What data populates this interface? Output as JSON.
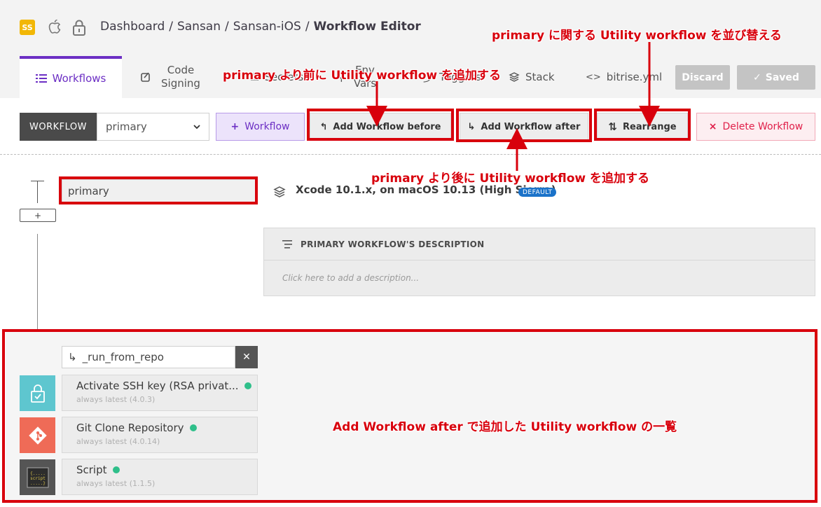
{
  "header": {
    "app_badge": "SS",
    "breadcrumb": [
      "Dashboard",
      "Sansan",
      "Sansan-iOS",
      "Workflow Editor"
    ],
    "separator": "/"
  },
  "tabs": [
    {
      "label": "Workflows",
      "icon": "list-icon",
      "active": true
    },
    {
      "label": "Code Signing",
      "icon": "code-signing-icon"
    },
    {
      "label": "Secrets",
      "icon": "secrets-icon"
    },
    {
      "label": "Env Vars",
      "icon": "env-vars-icon"
    },
    {
      "label": "Triggers",
      "icon": "triggers-icon"
    },
    {
      "label": "Stack",
      "icon": "stack-icon"
    },
    {
      "label": "bitrise.yml",
      "icon": "code-icon"
    }
  ],
  "actions": {
    "discard": "Discard",
    "saved": "Saved"
  },
  "toolbar": {
    "workflow_label": "WORKFLOW",
    "selected_workflow": "primary",
    "add_workflow": "Workflow",
    "add_before": "Add Workflow before",
    "add_after": "Add Workflow after",
    "rearrange": "Rearrange",
    "delete": "Delete Workflow"
  },
  "workflow": {
    "name": "primary",
    "plus": "+",
    "stack": "Xcode 10.1.x, on macOS 10.13 (High Sierra)",
    "stack_badge": "DEFAULT",
    "description_title": "PRIMARY WORKFLOW'S DESCRIPTION",
    "description_placeholder": "Click here to add a description..."
  },
  "utility": {
    "run_from": "_run_from_repo",
    "steps": [
      {
        "title": "Activate SSH key (RSA privat...",
        "version": "always latest (4.0.3)",
        "icon": "ssh-key-icon",
        "color": "#5ec6cf"
      },
      {
        "title": "Git Clone Repository",
        "version": "always latest (4.0.14)",
        "icon": "git-icon",
        "color": "#ef6b57"
      },
      {
        "title": "Script",
        "version": "always latest (1.1.5)",
        "icon": "script-icon",
        "color": "#555555"
      }
    ]
  },
  "annotations": {
    "before": "primary より前に Utility workflow を追加する",
    "rearrange": "primary に関する Utility workflow を並び替える",
    "after": "primary より後に Utility workflow を追加する",
    "list": "Add Workflow after で追加した Utility workflow の一覧"
  },
  "colors": {
    "accent": "#6c2fc4",
    "annotation": "#d8000c",
    "delete": "#e0204a",
    "badge": "#1a72c9"
  }
}
